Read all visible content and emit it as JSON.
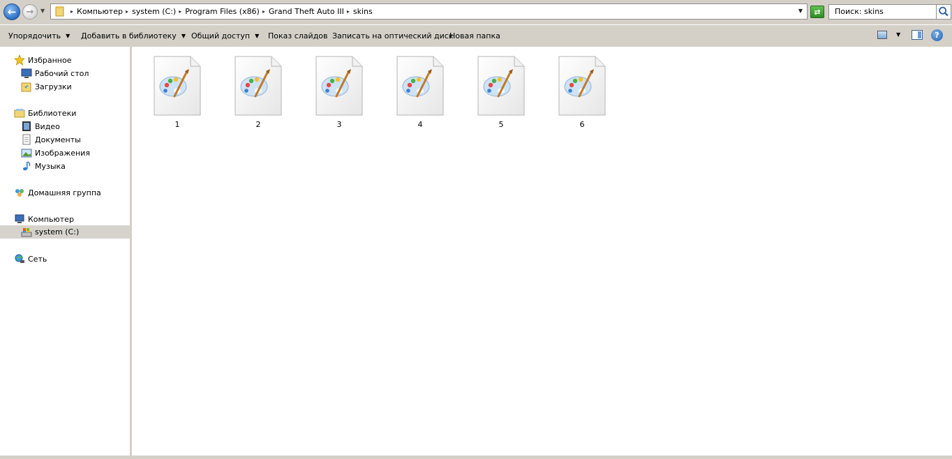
{
  "addressbar": {
    "breadcrumbs": [
      "Компьютер",
      "system (C:)",
      "Program Files (x86)",
      "Grand Theft Auto III",
      "skins"
    ],
    "search_text": "Поиск: skins"
  },
  "toolbar": {
    "organize": "Упорядочить",
    "add_to_library": "Добавить в библиотеку",
    "share": "Общий доступ",
    "slideshow": "Показ слайдов",
    "burn": "Записать на оптический диск",
    "new_folder": "Новая папка"
  },
  "navpane": {
    "favorites": "Избранное",
    "desktop": "Рабочий стол",
    "downloads": "Загрузки",
    "libraries": "Библиотеки",
    "video": "Видео",
    "documents": "Документы",
    "images": "Изображения",
    "music": "Музыка",
    "homegroup": "Домашняя группа",
    "computer": "Компьютер",
    "system_drive": "system (C:)",
    "network": "Сеть"
  },
  "files": [
    {
      "name": "1",
      "icon": "paint-file-icon"
    },
    {
      "name": "2",
      "icon": "paint-file-icon"
    },
    {
      "name": "3",
      "icon": "paint-file-icon"
    },
    {
      "name": "4",
      "icon": "paint-file-icon"
    },
    {
      "name": "5",
      "icon": "paint-file-icon"
    },
    {
      "name": "6",
      "icon": "paint-file-icon"
    }
  ],
  "colors": {
    "chrome": "#d4d0c8",
    "selected": "#d6d3cd",
    "accent": "#2b6fc7"
  }
}
